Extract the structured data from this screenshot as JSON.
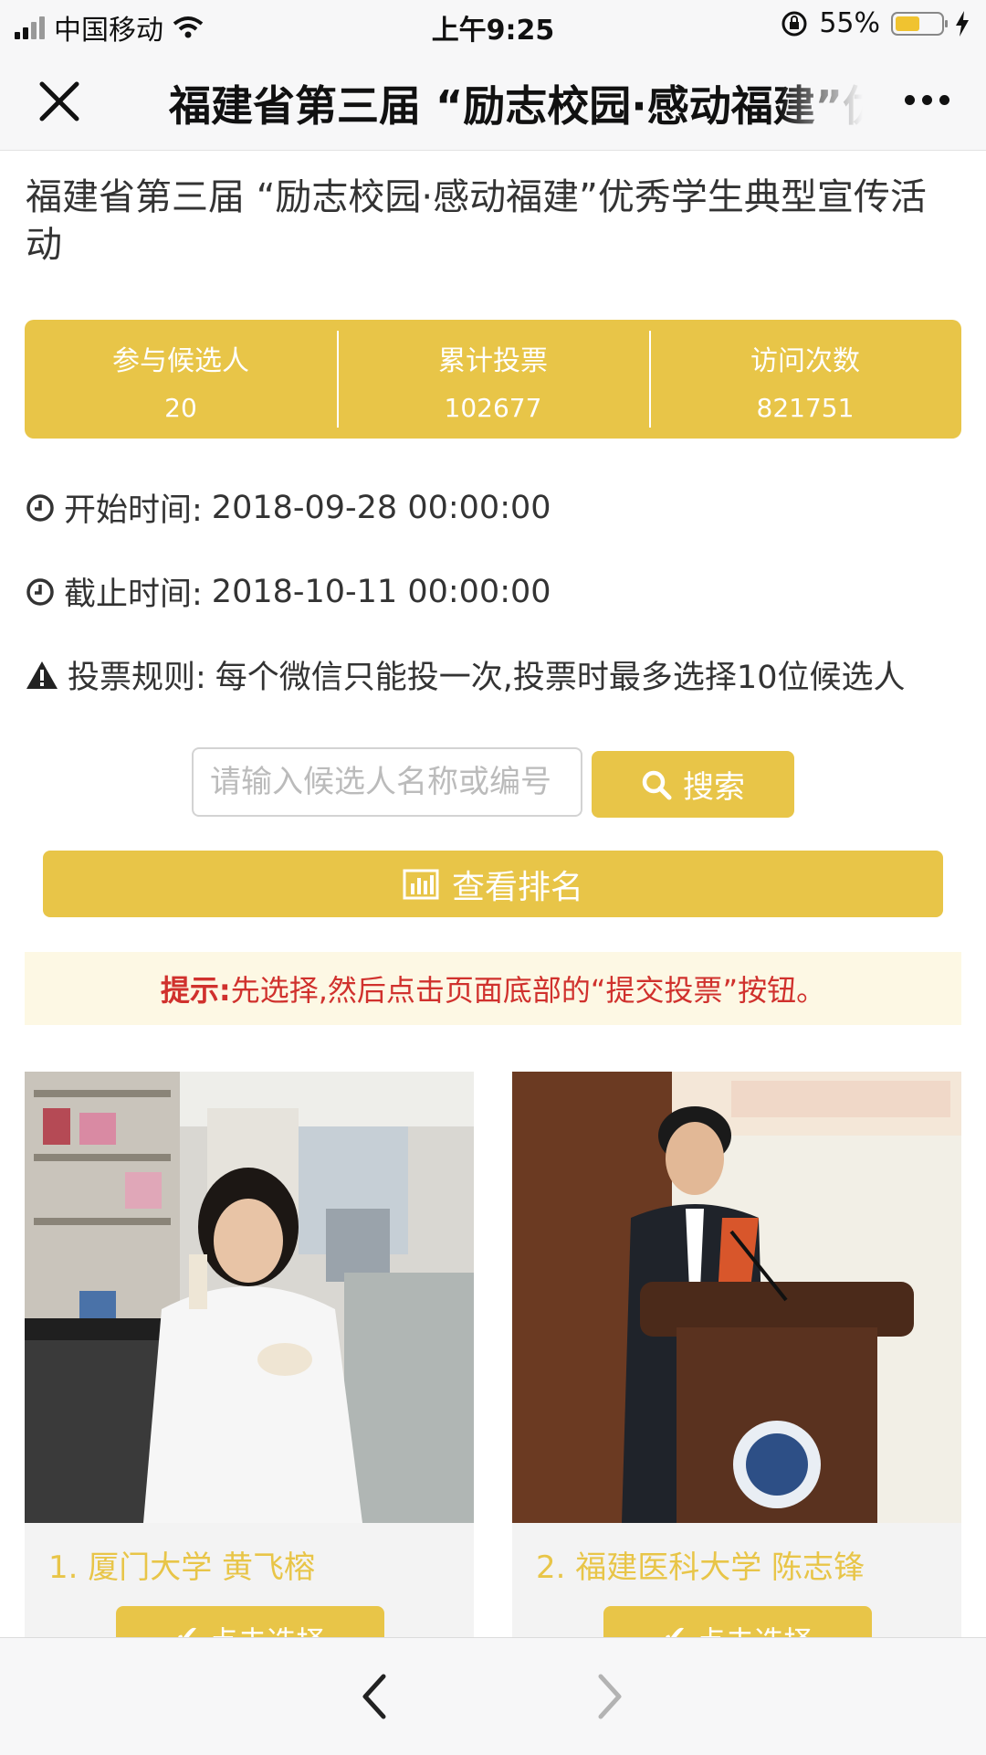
{
  "status_bar": {
    "carrier": "中国移动",
    "time": "上午9:25",
    "battery_percent": "55%",
    "battery_level": 0.55
  },
  "nav": {
    "title": "福建省第三届 “励志校园·感动福建”优秀学生典型宣传活动"
  },
  "page": {
    "title": "福建省第三届 “励志校园·感动福建”优秀学生典型宣传活动"
  },
  "stats": [
    {
      "label": "参与候选人",
      "value": "20"
    },
    {
      "label": "累计投票",
      "value": "102677"
    },
    {
      "label": "访问次数",
      "value": "821751"
    }
  ],
  "info": {
    "start_label": "开始时间:",
    "start_value": "2018-09-28 00:00:00",
    "end_label": "截止时间:",
    "end_value": "2018-10-11 00:00:00",
    "rule_label": "投票规则:",
    "rule_value": "每个微信只能投一次,投票时最多选择10位候选人"
  },
  "search": {
    "placeholder": "请输入候选人名称或编号",
    "button_label": "搜索"
  },
  "rank_button_label": "查看排名",
  "tip": {
    "label": "提示:",
    "text": "先选择,然后点击页面底部的“提交投票”按钮。"
  },
  "candidates": [
    {
      "name": "1. 厦门大学 黄飞榕",
      "button_label": "点击选择"
    },
    {
      "name": "2. 福建医科大学 陈志锋",
      "button_label": "点击选择"
    }
  ],
  "colors": {
    "accent": "#e8c548",
    "tip_text": "#d0312d",
    "tip_bg": "#fdf8e4"
  }
}
